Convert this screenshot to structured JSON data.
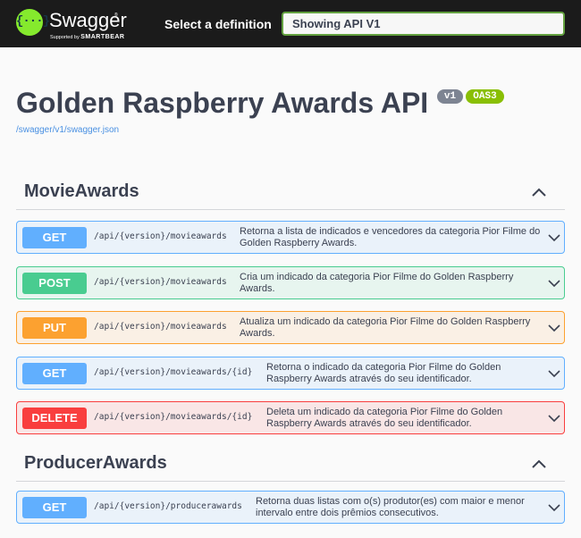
{
  "topbar": {
    "logo_glyph": "{···}",
    "brand": "Swagger",
    "tm": "®",
    "supported_prefix": "Supported by",
    "supported_brand": "SMARTBEAR",
    "definition_label": "Select a definition",
    "definition_value": "Showing API V1"
  },
  "info": {
    "title": "Golden Raspberry Awards API",
    "version_badge": "v1",
    "oas_badge": "OAS3",
    "spec_link": "/swagger/v1/swagger.json"
  },
  "tags": [
    {
      "name": "MovieAwards",
      "operations": [
        {
          "method": "GET",
          "path": "/api/{version}/movieawards",
          "summary": "Retorna a lista de indicados e vencedores da categoria Pior Filme do Golden Raspberry Awards."
        },
        {
          "method": "POST",
          "path": "/api/{version}/movieawards",
          "summary": "Cria um indicado da categoria Pior Filme do Golden Raspberry Awards."
        },
        {
          "method": "PUT",
          "path": "/api/{version}/movieawards",
          "summary": "Atualiza um indicado da categoria Pior Filme do Golden Raspberry Awards."
        },
        {
          "method": "GET",
          "path": "/api/{version}/movieawards/{id}",
          "summary": "Retorna o indicado da categoria Pior Filme do Golden Raspberry Awards através do seu identificador."
        },
        {
          "method": "DELETE",
          "path": "/api/{version}/movieawards/{id}",
          "summary": "Deleta um indicado da categoria Pior Filme do Golden Raspberry Awards através do seu identificador."
        }
      ]
    },
    {
      "name": "ProducerAwards",
      "operations": [
        {
          "method": "GET",
          "path": "/api/{version}/producerawards",
          "summary": "Retorna duas listas com o(s) produtor(es) com maior e menor intervalo entre dois prêmios consecutivos."
        }
      ]
    }
  ],
  "colors": {
    "get": "#61affe",
    "post": "#49cc90",
    "put": "#fca130",
    "delete": "#f93e3e",
    "topbar": "#1b1b1b",
    "accent": "#85ea2d"
  },
  "icons": {
    "tag_collapse": "chevron-up-icon",
    "op_expand": "chevron-down-icon"
  }
}
